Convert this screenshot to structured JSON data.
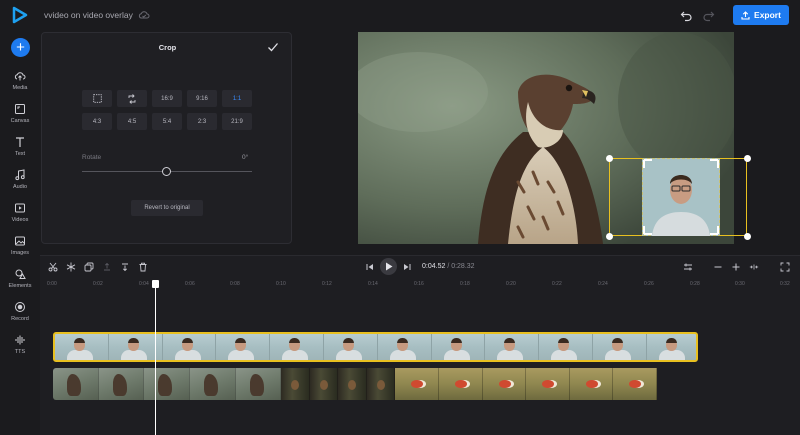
{
  "topbar": {
    "project_title": "vvideo on video overlay",
    "export_label": "Export"
  },
  "sidebar": {
    "add_label": "+",
    "items": [
      {
        "label": "Media",
        "icon": "cloud-upload-icon"
      },
      {
        "label": "Canvas",
        "icon": "canvas-icon"
      },
      {
        "label": "Text",
        "icon": "text-icon"
      },
      {
        "label": "Audio",
        "icon": "music-note-icon"
      },
      {
        "label": "Videos",
        "icon": "video-icon"
      },
      {
        "label": "Images",
        "icon": "image-icon"
      },
      {
        "label": "Elements",
        "icon": "elements-icon"
      },
      {
        "label": "Record",
        "icon": "record-icon"
      },
      {
        "label": "TTS",
        "icon": "tts-icon"
      }
    ]
  },
  "crop_panel": {
    "title": "Crop",
    "ratios_row1": [
      "16:9",
      "9:16",
      "1:1"
    ],
    "ratios_row2": [
      "4:3",
      "4:5",
      "5:4",
      "2:3",
      "21:9"
    ],
    "active_ratio": "1:1",
    "rotate_label": "Rotate",
    "rotate_value": "0°",
    "revert_label": "Revert to original"
  },
  "timeline": {
    "current_time": "0:04.52",
    "total_time": "/ 0:28.32",
    "ticks": [
      "0:00",
      "0:02",
      "0:04",
      "0:06",
      "0:08",
      "0:10",
      "0:12",
      "0:14",
      "0:16",
      "0:18",
      "0:20",
      "0:22",
      "0:24",
      "0:26",
      "0:28",
      "0:30",
      "0:32"
    ]
  },
  "colors": {
    "accent": "#1e7bf0",
    "selection": "#e8c020",
    "panel_bg": "#1f1f23"
  }
}
